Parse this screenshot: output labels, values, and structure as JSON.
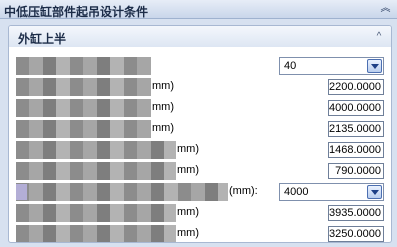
{
  "panel": {
    "title": "中低压缸部件起吊设计条件",
    "collapse_glyph": "︽"
  },
  "group": {
    "title": "外缸上半",
    "collapse_glyph": "^"
  },
  "rows": [
    {
      "type": "combo",
      "unit": "",
      "value": "40"
    },
    {
      "type": "text",
      "unit": "mm)",
      "value": "2200.0000"
    },
    {
      "type": "text",
      "unit": "mm)",
      "value": "4000.0000"
    },
    {
      "type": "text",
      "unit": "mm)",
      "value": "2135.0000"
    },
    {
      "type": "text",
      "unit": "mm)",
      "value": "1468.0000"
    },
    {
      "type": "text",
      "unit": "mm)",
      "value": "790.0000"
    },
    {
      "type": "combo",
      "unit": "(mm):",
      "value": "4000"
    },
    {
      "type": "text",
      "unit": "mm)",
      "value": "3935.0000"
    },
    {
      "type": "text",
      "unit": "mm)",
      "value": "3250.0000"
    }
  ]
}
